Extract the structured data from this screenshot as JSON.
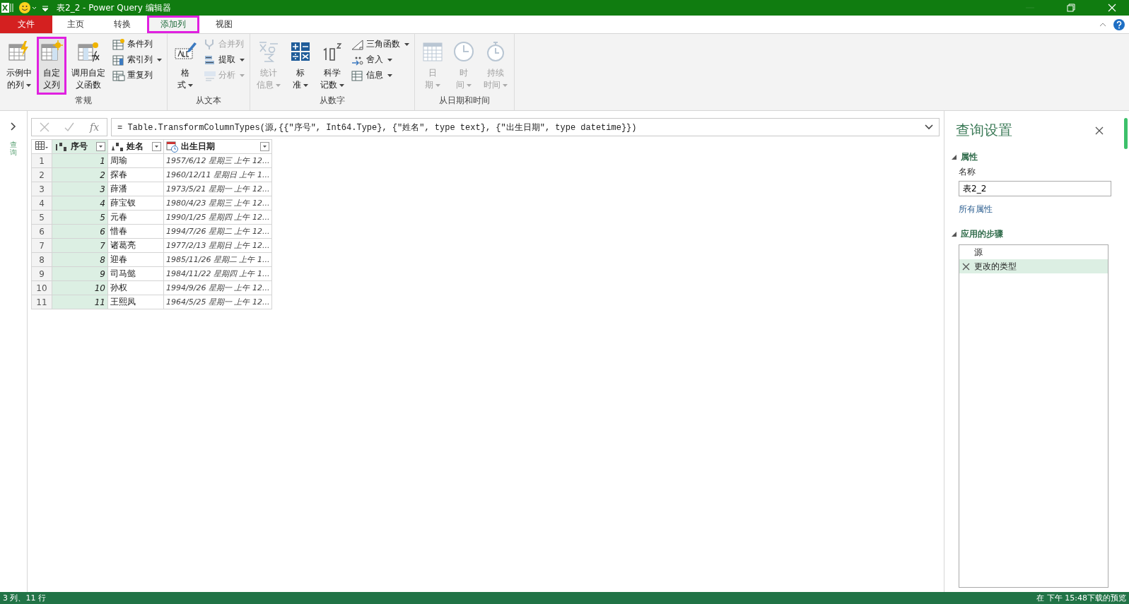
{
  "window": {
    "title": "表2_2 - Power Query 编辑器"
  },
  "tabs": [
    {
      "label": "文件",
      "kind": "file",
      "selected": false,
      "highlighted": false
    },
    {
      "label": "主页",
      "kind": "tab",
      "selected": false,
      "highlighted": false
    },
    {
      "label": "转换",
      "kind": "tab",
      "selected": false,
      "highlighted": false
    },
    {
      "label": "添加列",
      "kind": "tab",
      "selected": true,
      "highlighted": true
    },
    {
      "label": "视图",
      "kind": "tab",
      "selected": false,
      "highlighted": false
    }
  ],
  "ribbon_groups": [
    {
      "label": "常规",
      "items": [
        {
          "kind": "large",
          "lines": [
            "示例中",
            "的列"
          ],
          "has_menu": true,
          "disabled": false,
          "highlighted": false
        },
        {
          "kind": "large",
          "lines": [
            "自定",
            "义列"
          ],
          "has_menu": false,
          "disabled": false,
          "highlighted": true
        },
        {
          "kind": "large",
          "lines": [
            "调用自定",
            "义函数"
          ],
          "has_menu": false,
          "disabled": false,
          "highlighted": false
        },
        {
          "kind": "stack",
          "items": [
            {
              "label": "条件列",
              "has_menu": false,
              "disabled": false
            },
            {
              "label": "索引列",
              "has_menu": true,
              "disabled": false
            },
            {
              "label": "重复列",
              "has_menu": false,
              "disabled": false
            }
          ]
        }
      ]
    },
    {
      "label": "从文本",
      "items": [
        {
          "kind": "large",
          "lines": [
            "格",
            "式"
          ],
          "has_menu": true,
          "disabled": false,
          "highlighted": false
        },
        {
          "kind": "stack",
          "items": [
            {
              "label": "合并列",
              "has_menu": false,
              "disabled": true
            },
            {
              "label": "提取",
              "has_menu": true,
              "disabled": false
            },
            {
              "label": "分析",
              "has_menu": true,
              "disabled": true
            }
          ]
        }
      ]
    },
    {
      "label": "从数字",
      "items": [
        {
          "kind": "large",
          "lines": [
            "统计",
            "信息"
          ],
          "has_menu": true,
          "disabled": true,
          "highlighted": false
        },
        {
          "kind": "large",
          "lines": [
            "标",
            "准"
          ],
          "has_menu": true,
          "disabled": false,
          "highlighted": false
        },
        {
          "kind": "large",
          "lines": [
            "科学",
            "记数"
          ],
          "has_menu": true,
          "disabled": false,
          "highlighted": false
        },
        {
          "kind": "stack",
          "items": [
            {
              "label": "三角函数",
              "has_menu": true,
              "disabled": false
            },
            {
              "label": "舍入",
              "has_menu": true,
              "disabled": false
            },
            {
              "label": "信息",
              "has_menu": true,
              "disabled": false
            }
          ]
        }
      ]
    },
    {
      "label": "从日期和时间",
      "items": [
        {
          "kind": "large",
          "lines": [
            "日",
            "期"
          ],
          "has_menu": true,
          "disabled": true,
          "highlighted": false
        },
        {
          "kind": "large",
          "lines": [
            "时",
            "间"
          ],
          "has_menu": true,
          "disabled": true,
          "highlighted": false
        },
        {
          "kind": "large",
          "lines": [
            "持续",
            "时间"
          ],
          "has_menu": true,
          "disabled": true,
          "highlighted": false
        }
      ]
    }
  ],
  "queries_pane": {
    "label": "查询",
    "expanded": false
  },
  "formula_bar": {
    "fx": "fx",
    "formula": "= Table.TransformColumnTypes(源,{{\"序号\", Int64.Type}, {\"姓名\", type text}, {\"出生日期\", type datetime}})"
  },
  "table": {
    "columns": [
      {
        "label": "序号",
        "kind": "number",
        "selected": true
      },
      {
        "label": "姓名",
        "kind": "text",
        "selected": false
      },
      {
        "label": "出生日期",
        "kind": "datetime",
        "selected": false
      }
    ],
    "rows": [
      {
        "index": "1",
        "cells": [
          "1",
          "周瑜",
          "1957/6/12 星期三 上午 12..."
        ]
      },
      {
        "index": "2",
        "cells": [
          "2",
          "探春",
          "1960/12/11 星期日 上午 1..."
        ]
      },
      {
        "index": "3",
        "cells": [
          "3",
          "薛潘",
          "1973/5/21 星期一 上午 12..."
        ]
      },
      {
        "index": "4",
        "cells": [
          "4",
          "薛宝钗",
          "1980/4/23 星期三 上午 12..."
        ]
      },
      {
        "index": "5",
        "cells": [
          "5",
          "元春",
          "1990/1/25 星期四 上午 12..."
        ]
      },
      {
        "index": "6",
        "cells": [
          "6",
          "惜春",
          "1994/7/26 星期二 上午 12..."
        ]
      },
      {
        "index": "7",
        "cells": [
          "7",
          "诸葛亮",
          "1977/2/13 星期日 上午 12..."
        ]
      },
      {
        "index": "8",
        "cells": [
          "8",
          "迎春",
          "1985/11/26 星期二 上午 1..."
        ]
      },
      {
        "index": "9",
        "cells": [
          "9",
          "司马懿",
          "1984/11/22 星期四 上午 1..."
        ]
      },
      {
        "index": "10",
        "cells": [
          "10",
          "孙权",
          "1994/9/26 星期一 上午 12..."
        ]
      },
      {
        "index": "11",
        "cells": [
          "11",
          "王熙凤",
          "1964/5/25 星期一 上午 12..."
        ]
      }
    ]
  },
  "query_settings": {
    "title": "查询设置",
    "properties": {
      "heading": "属性",
      "expanded": true,
      "name_label": "名称",
      "name_value": "表2_2",
      "all_properties_link": "所有属性"
    },
    "steps": {
      "heading": "应用的步骤",
      "expanded": true,
      "items": [
        {
          "label": "源",
          "selected": false
        },
        {
          "label": "更改的类型",
          "selected": true
        }
      ]
    }
  },
  "status_bar": {
    "left": "3 列、11 行",
    "right": "在 下午 15:48下载的预览"
  }
}
